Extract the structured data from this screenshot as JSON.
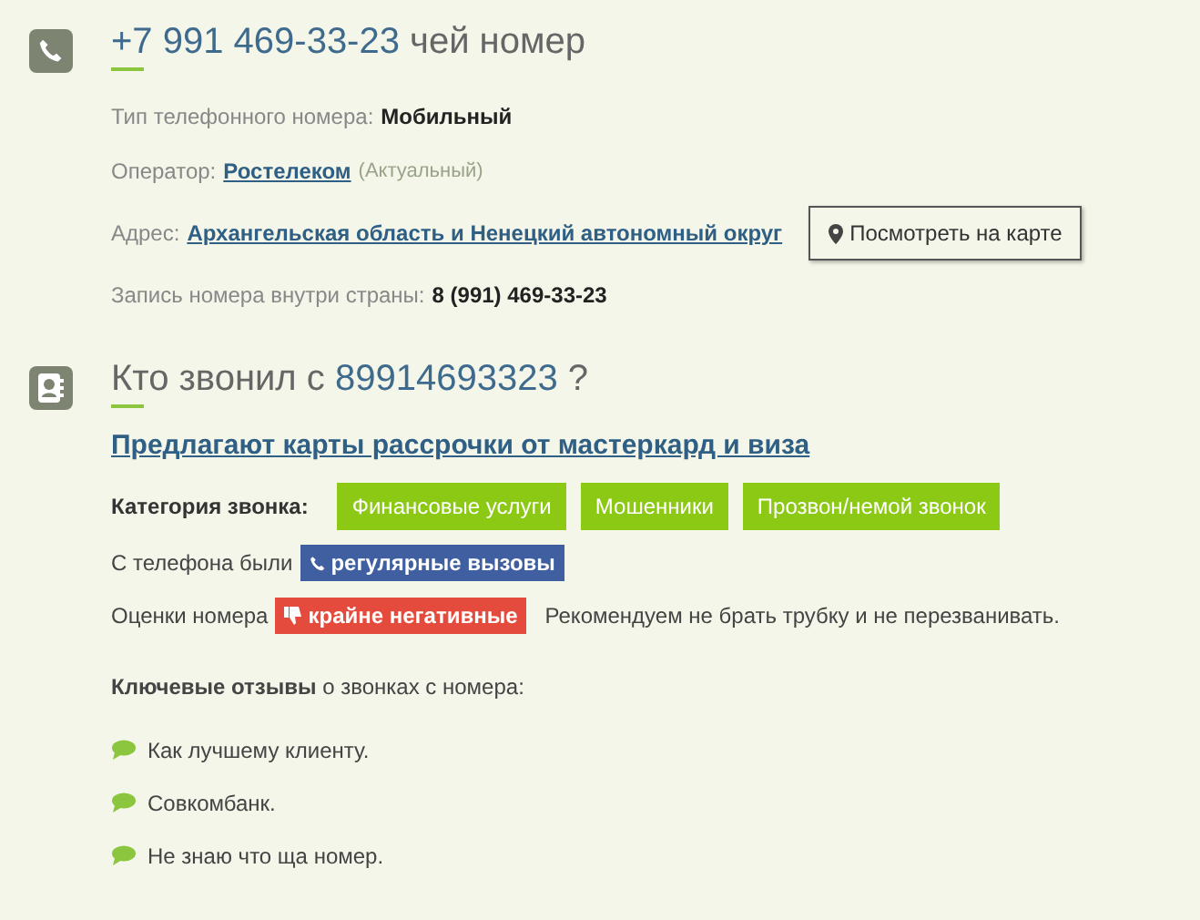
{
  "number_section": {
    "title_number": "+7 991 469-33-23",
    "title_suffix": "чей номер",
    "fields": [
      {
        "kind": "text",
        "label": "Тип телефонного номера:",
        "value": "Мобильный"
      },
      {
        "kind": "link",
        "label": "Оператор:",
        "value": "Ростелеком",
        "note": "(Актуальный)"
      },
      {
        "kind": "address",
        "label": "Адрес:",
        "value": "Архангельская область и Ненецкий автономный округ",
        "button": "Посмотреть на карте"
      },
      {
        "kind": "text",
        "label": "Запись номера внутри страны:",
        "value": "8 (991) 469-33-23"
      }
    ]
  },
  "caller_section": {
    "title_prefix": "Кто звонил с",
    "title_number": "89914693323",
    "title_suffix": "?",
    "headline": "Предлагают карты рассрочки от мастеркард и виза",
    "category_label": "Категория звонка:",
    "categories": [
      "Финансовые услуги",
      "Мошенники",
      "Прозвон/немой звонок"
    ],
    "calls_label": "С телефона были",
    "calls_badge": "регулярные вызовы",
    "rating_label": "Оценки номера",
    "rating_badge": "крайне негативные",
    "rating_advice": "Рекомендуем не брать трубку и не перезванивать.",
    "reviews_intro": "**Ключевые отзывы** о звонках с номера:",
    "reviews": [
      "Как лучшему клиенту.",
      "Совкомбанк.",
      "Не знаю что ща номер."
    ]
  }
}
